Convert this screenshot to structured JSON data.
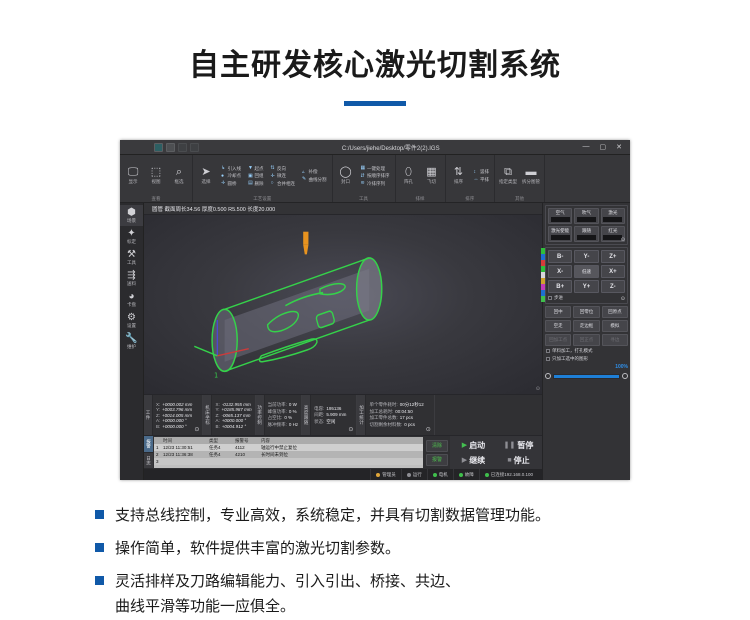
{
  "heading": {
    "title": "自主研发核心激光切割系统"
  },
  "app": {
    "titlebar": {
      "path": "C:/Users/jiehe/Desktop/零件2(2).IGS",
      "minimize": "—",
      "maximize": "▢",
      "close": "✕",
      "icons": [
        "open-file-icon",
        "save-icon",
        "undo-icon",
        "redo-icon"
      ]
    },
    "ribbon": {
      "groups": [
        {
          "name": "显示",
          "title": "查看",
          "big": [
            {
              "icon": "monitor-icon",
              "label": "显示"
            },
            {
              "icon": "cube-icon",
              "label": "视图"
            },
            {
              "icon": "zoom-icon",
              "label": "框选"
            }
          ],
          "items": []
        },
        {
          "name": "工艺设置",
          "title": "工艺设置",
          "big": [
            {
              "icon": "cursor-icon",
              "label": "选择"
            }
          ],
          "items": [
            "引入线",
            "起点",
            "反向",
            "补偿",
            "冷却点",
            "回组",
            "微连",
            "曲线分割",
            "圆桥",
            "删除",
            "合并相连"
          ]
        },
        {
          "name": "工具",
          "title": "工具",
          "big": [
            {
              "icon": "circle-icon",
              "label": "封口"
            }
          ],
          "items": [
            "一键处理",
            "按顺序排序",
            "冷排序列"
          ]
        },
        {
          "name": "排样",
          "title": "排样",
          "big": [
            {
              "icon": "holes-icon",
              "label": "阵孔"
            },
            {
              "icon": "grid-icon",
              "label": "飞切"
            }
          ],
          "items": []
        },
        {
          "name": "排序",
          "title": "排序",
          "big": [
            {
              "icon": "sort-icon",
              "label": "排序"
            }
          ],
          "items": [
            "竖排",
            "平排"
          ]
        },
        {
          "name": "其他",
          "title": "其他",
          "big": [
            {
              "icon": "tube-icon",
              "label": "指定类型"
            },
            {
              "icon": "line-icon",
              "label": "拆分图管"
            }
          ],
          "items": []
        }
      ]
    },
    "rail": [
      {
        "icon": "cube-scene-icon",
        "label": "场景"
      },
      {
        "icon": "calibrate-icon",
        "label": "标定"
      },
      {
        "icon": "tools-icon",
        "label": "工具"
      },
      {
        "icon": "feed-icon",
        "label": "送料"
      },
      {
        "icon": "chuck-icon",
        "label": "卡盘"
      },
      {
        "icon": "settings-gear-icon",
        "label": "设置"
      },
      {
        "icon": "wrench-icon",
        "label": "维护"
      }
    ],
    "infobar": {
      "text": "圆管 截面周长34.56 厚度0.500 R5.500 长度20.000"
    },
    "viewport": {
      "axis_labels": [
        "x",
        "y",
        "z"
      ],
      "part_label": "1",
      "corner_badge": "⊙"
    },
    "status": {
      "blocks": [
        {
          "tab": "工件",
          "rows": [
            {
              "k": "X:",
              "v": "+0000.002 mm"
            },
            {
              "k": "Y:",
              "v": "+0003.796 mm"
            },
            {
              "k": "Z:",
              "v": "+0014.005 mm"
            },
            {
              "k": "A:",
              "v": "+0000.000 °"
            },
            {
              "k": "B:",
              "v": "+0000.000 °"
            }
          ],
          "corner": "工件"
        },
        {
          "tab": "机床坐标",
          "rows": [
            {
              "k": "X:",
              "v": "-0132.955 mm"
            },
            {
              "k": "Y:",
              "v": "+0185.987 mm"
            },
            {
              "k": "Z:",
              "v": "-0065.137 mm"
            },
            {
              "k": "A:",
              "v": "+0000.000 °"
            },
            {
              "k": "B:",
              "v": "+0004.912 °"
            }
          ],
          "corner": ""
        },
        {
          "tab": "功率控制",
          "rows": [
            {
              "k": "当前功率:",
              "v": "0 W"
            },
            {
              "k": "峰值功率:",
              "v": "0 %"
            },
            {
              "k": "占空比:",
              "v": "0 %"
            },
            {
              "k": "脉冲频率:",
              "v": "0 Hz"
            }
          ],
          "corner": ""
        },
        {
          "tab": "高度跟随",
          "rows": [
            {
              "k": "电容:",
              "v": "195136"
            },
            {
              "k": "间距:",
              "v": "5.909 mm"
            },
            {
              "k": "状态:",
              "v": "空闲"
            }
          ],
          "corner": "⊙"
        },
        {
          "tab": "加工统计",
          "rows": [
            {
              "k": "单个零件耗时:",
              "v": "00分12秒12"
            },
            {
              "k": "加工总耗时:",
              "v": "00:04:50"
            },
            {
              "k": "加工零件总数:",
              "v": "17 pcs"
            },
            {
              "k": "切割剩余材料数:",
              "v": "0 pcs"
            }
          ],
          "corner": "⊙"
        }
      ]
    },
    "log": {
      "tabs": [
        "报警",
        "日志"
      ],
      "columns": [
        "",
        "时间",
        "类型",
        "报警号",
        "内容"
      ],
      "rows": [
        {
          "n": "1",
          "time": "12/23 11:30:51",
          "type": "任务4",
          "code": "4112",
          "msg": "轴运行中禁止复位"
        },
        {
          "n": "2",
          "time": "12/23 11:36:38",
          "type": "任务4",
          "code": "4210",
          "msg": "长时间未到位"
        },
        {
          "n": "3",
          "time": "",
          "type": "",
          "code": "",
          "msg": ""
        }
      ],
      "side_buttons": [
        "清除",
        "报警"
      ]
    },
    "run_buttons": [
      {
        "glyph": "▶",
        "label": "启动",
        "state": "green"
      },
      {
        "glyph": "❚❚",
        "label": "暂停",
        "state": "grey"
      },
      {
        "glyph": "▶",
        "label": "继续",
        "state": "grey"
      },
      {
        "glyph": "■",
        "label": "停止",
        "state": "grey"
      }
    ],
    "right_panel": {
      "toggles_row1": [
        "空气",
        "吹气",
        "激光"
      ],
      "toggles_row2": [
        "激光使能",
        "跟随",
        "红光"
      ],
      "jog": [
        "B-",
        "Y-",
        "Z+",
        "X-",
        "低速",
        "X+",
        "B+",
        "Y+",
        "Z-"
      ],
      "step_label": "步进",
      "buttons_row1": [
        "回中",
        "回零位",
        "回原点"
      ],
      "buttons_row2": [
        "空走",
        "走边框",
        "模拟"
      ],
      "buttons_row3": [
        "回加工点",
        "回正点",
        "寻边"
      ],
      "checks": [
        "单料加工，打孔模式",
        "只加工选中的图形"
      ],
      "progress": {
        "percent": "100%",
        "value": 100
      }
    },
    "bottombar": [
      {
        "icon": "user-icon",
        "label": "管理员",
        "color": "#e0a63a"
      },
      {
        "icon": "run-icon",
        "label": "运行",
        "color": "#8e8e94"
      },
      {
        "icon": "motor-icon",
        "label": "电机",
        "color": "#3fbf4c"
      },
      {
        "icon": "fault-icon",
        "label": "故障",
        "color": "#3fbf4c"
      },
      {
        "icon": "link-icon",
        "label": "已连接192.168.0.100",
        "color": "#3fbf4c"
      }
    ]
  },
  "bullets": [
    {
      "text": "支持总线控制，专业高效，系统稳定，并具有切割数据管理功能。",
      "cont": ""
    },
    {
      "text": "操作简单，软件提供丰富的激光切割参数。",
      "cont": ""
    },
    {
      "text": "灵活排样及刀路编辑能力、引入引出、桥接、共边、",
      "cont": "曲线平滑等功能一应俱全。"
    }
  ],
  "colors": {
    "accent": "#1059a8",
    "green": "#3fbf4c",
    "path": "#35d24a"
  }
}
